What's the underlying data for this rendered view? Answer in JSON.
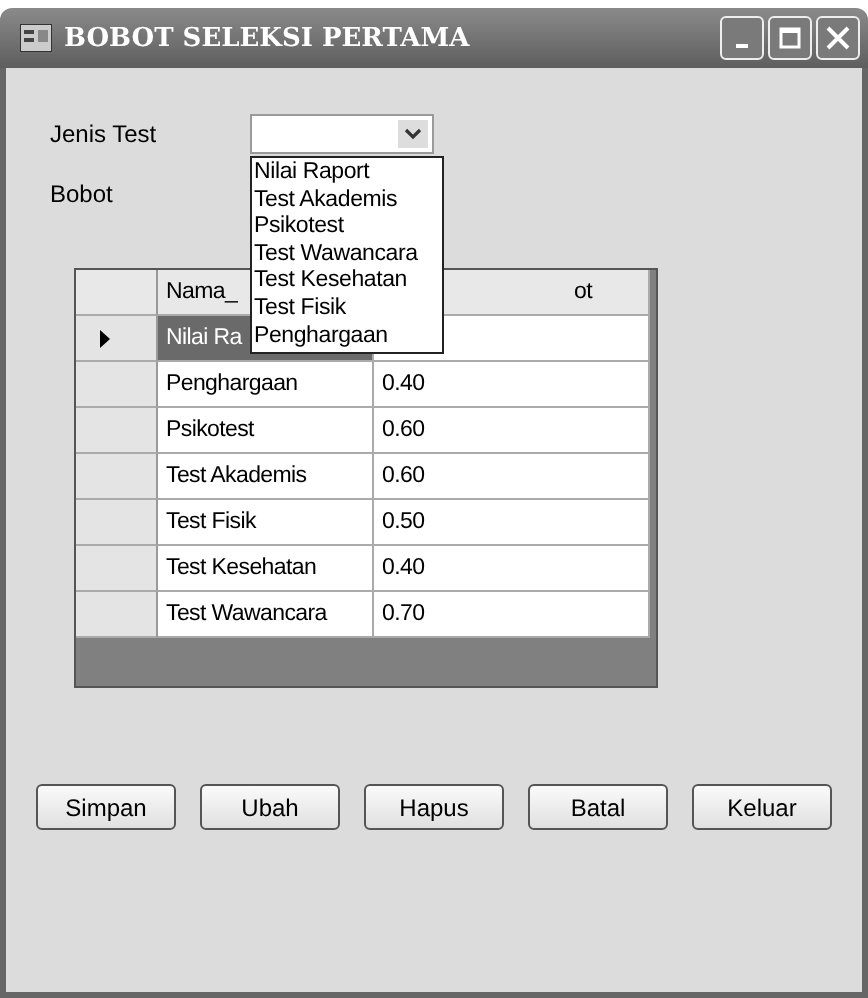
{
  "window": {
    "title": "BOBOT SELEKSI PERTAMA"
  },
  "form": {
    "jenis_label": "Jenis Test",
    "bobot_label": "Bobot"
  },
  "dropdown": {
    "open": true,
    "options": [
      {
        "label": "Nilai Raport",
        "selected": false
      },
      {
        "label": "Test Akademis",
        "selected": false
      },
      {
        "label": "Psikotest",
        "selected": false
      },
      {
        "label": "Test Wawancara",
        "selected": false
      },
      {
        "label": "Test Kesehatan",
        "selected": false
      },
      {
        "label": "Test Fisik",
        "selected": false
      },
      {
        "label": "Penghargaan",
        "selected": false
      }
    ]
  },
  "table": {
    "columns": [
      "Nama_",
      "ot"
    ],
    "rows": [
      {
        "cells": [
          "Nilai Ra"
        ],
        "selected": true
      },
      {
        "cells": [
          "Penghargaan",
          "0.40"
        ],
        "selected": false
      },
      {
        "cells": [
          "Psikotest",
          "0.60"
        ],
        "selected": false
      },
      {
        "cells": [
          "Test Akademis",
          "0.60"
        ],
        "selected": false
      },
      {
        "cells": [
          "Test Fisik",
          "0.50"
        ],
        "selected": false
      },
      {
        "cells": [
          "Test Kesehatan",
          "0.40"
        ],
        "selected": false
      },
      {
        "cells": [
          "Test Wawancara",
          "0.70"
        ],
        "selected": false
      }
    ]
  },
  "buttons": [
    "Simpan",
    "Ubah",
    "Hapus",
    "Batal",
    "Keluar"
  ]
}
